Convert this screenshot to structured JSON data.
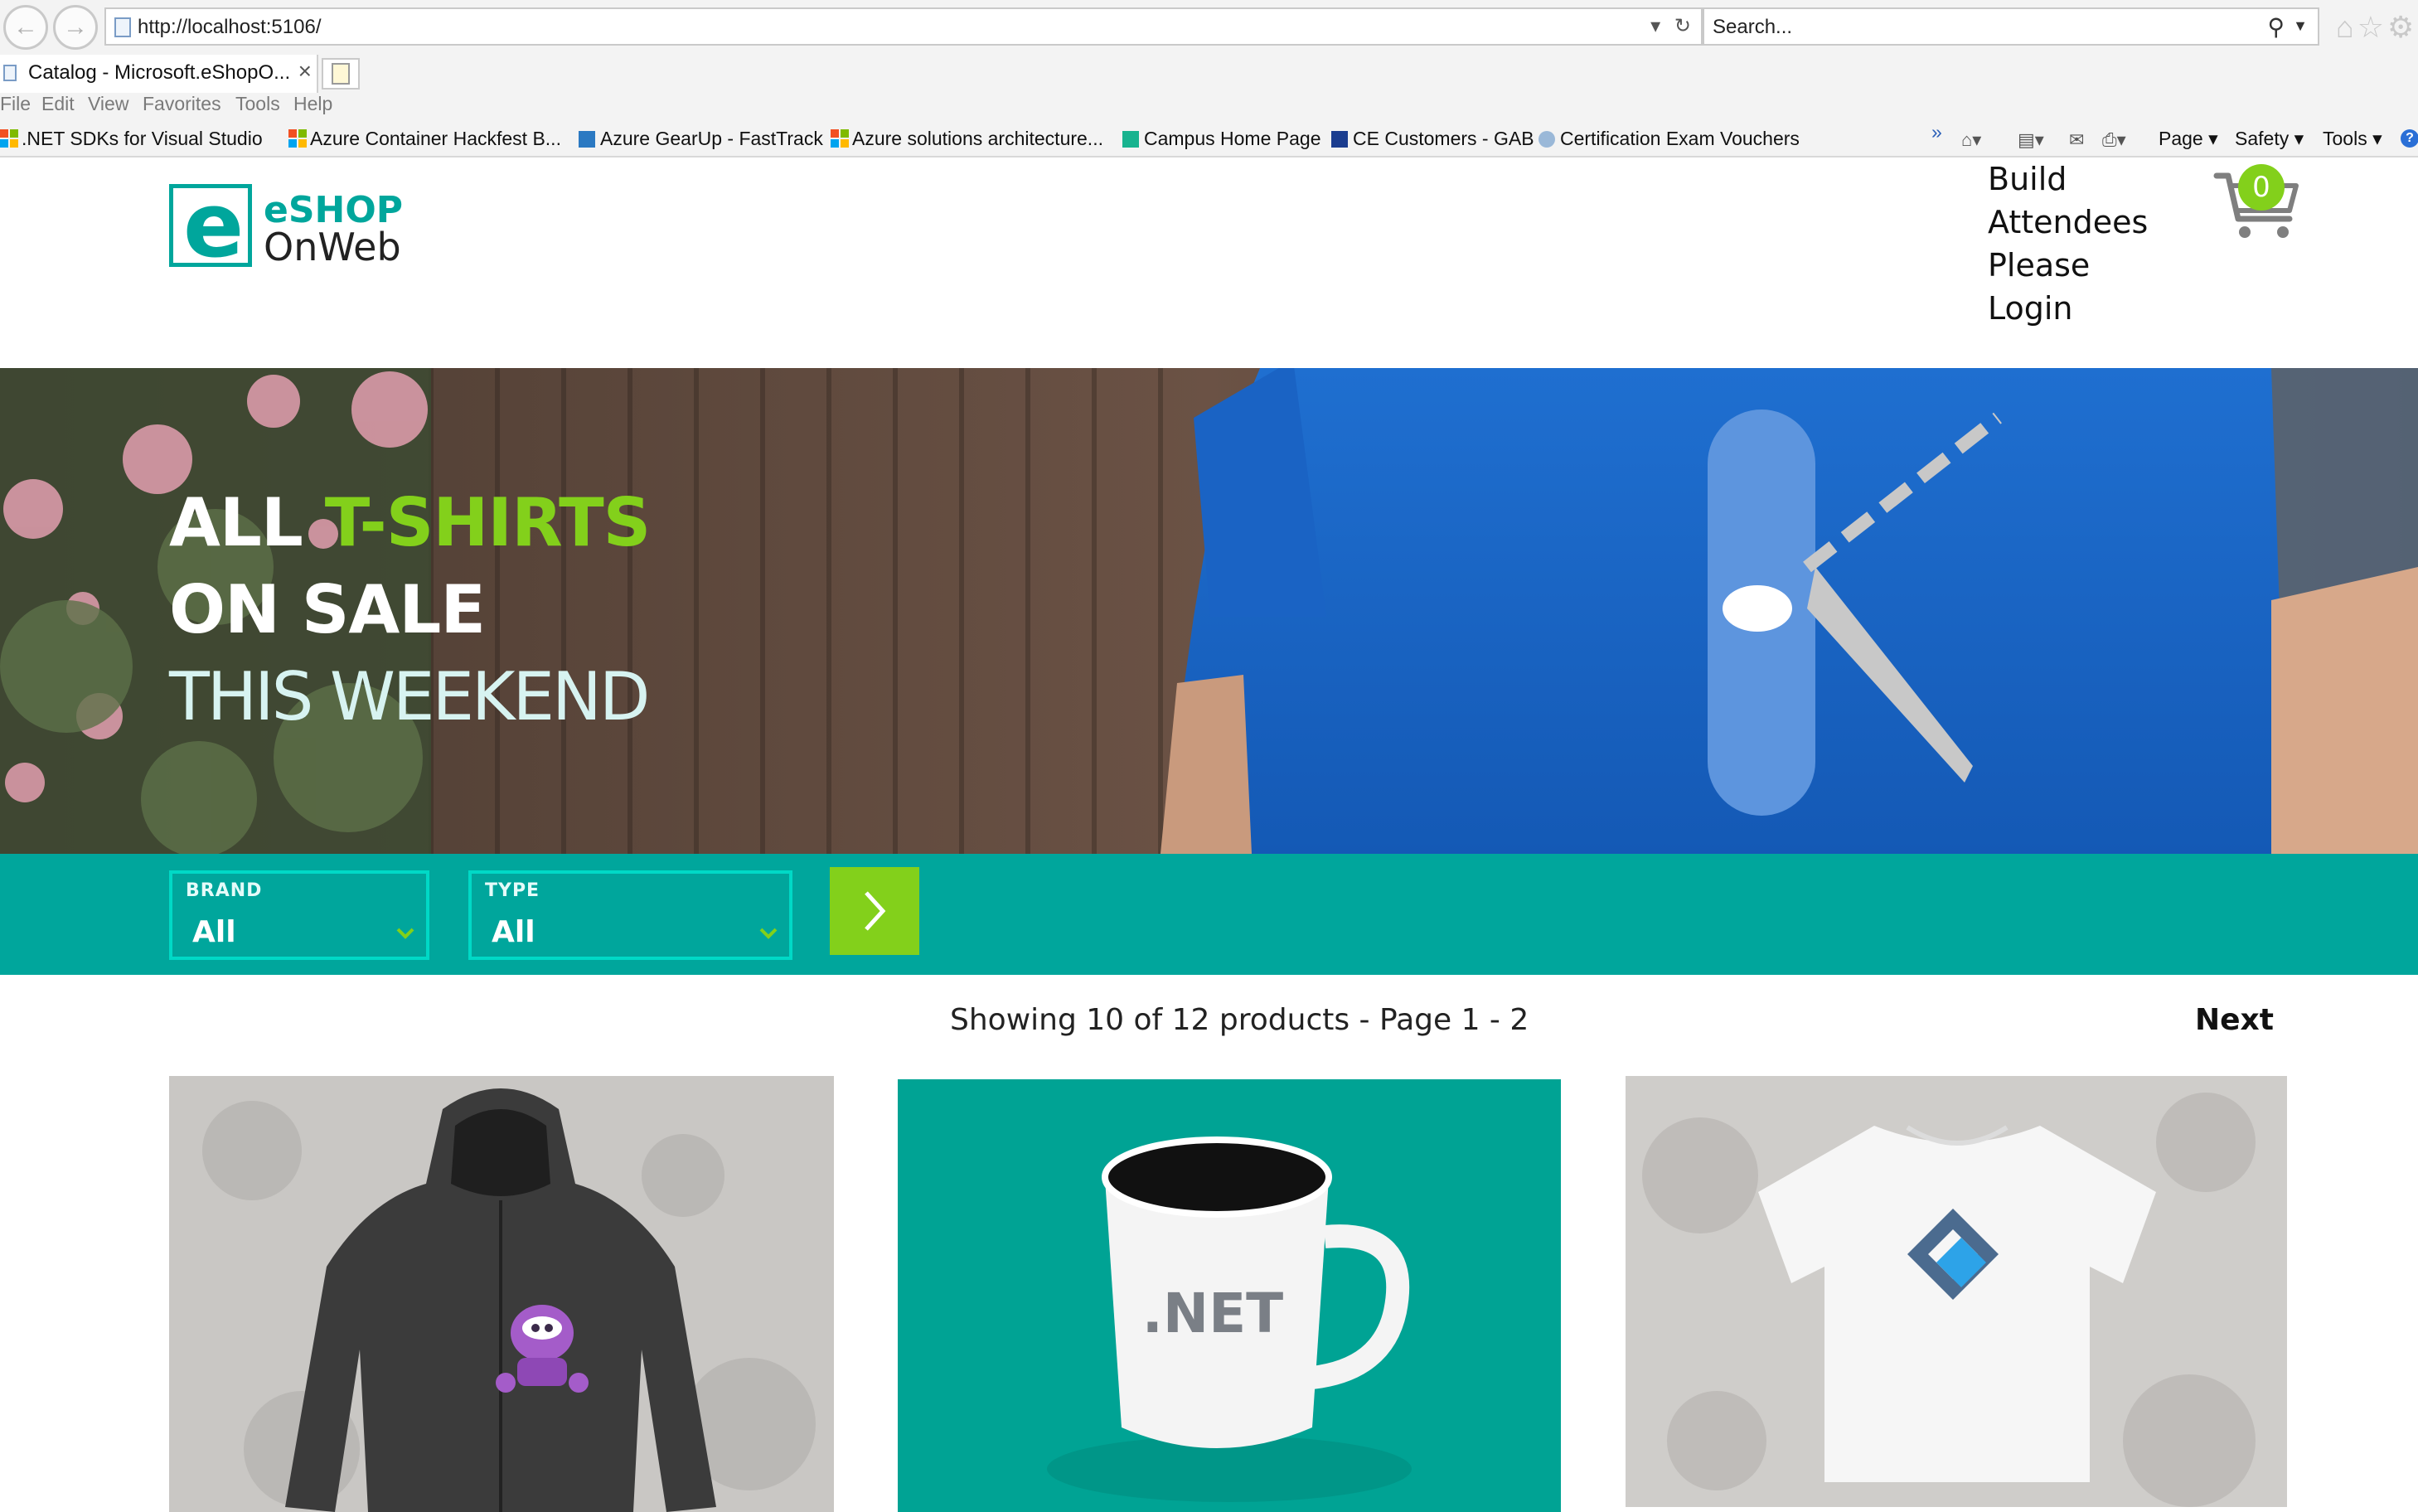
{
  "browser": {
    "url": "http://localhost:5106/",
    "search_placeholder": "Search...",
    "tab_title": "Catalog - Microsoft.eShopO...",
    "tab_close": "×",
    "menu": [
      "File",
      "Edit",
      "View",
      "Favorites",
      "Tools",
      "Help"
    ],
    "favorites": [
      ".NET SDKs for Visual Studio",
      "Azure Container Hackfest B...",
      "Azure GearUp - FastTrack",
      "Azure solutions architecture...",
      "Campus Home Page",
      "CE Customers - GAB",
      "Certification Exam Vouchers"
    ],
    "command_bar": {
      "more": "»",
      "page": "Page",
      "safety": "Safety",
      "tools": "Tools",
      "help": "?"
    }
  },
  "site": {
    "logo_line1": "eSHOP",
    "logo_line2": "OnWeb",
    "logo_letter": "e",
    "login_lines": [
      "Build",
      "Attendees",
      "Please",
      "Login"
    ],
    "cart_count": "0",
    "hero": {
      "line1_white": "ALL ",
      "line1_accent": "T-SHIRTS",
      "line2": "ON SALE",
      "line3": "THIS WEEKEND"
    },
    "filters": {
      "brand_label": "BRAND",
      "brand_value": "All",
      "type_label": "TYPE",
      "type_value": "All"
    },
    "pager": {
      "info": "Showing 10 of 12 products - Page 1 - 2",
      "next": "Next"
    },
    "products": [
      {
        "image": "hoodie-with-purple-robot-logo"
      },
      {
        "image": "white-mug-with-NET-logo",
        "mug_text": ".NET"
      },
      {
        "image": "white-tshirt-with-blue-diamond-logo"
      }
    ]
  },
  "colors": {
    "brand_teal": "#00a69c",
    "accent_green": "#83d01b",
    "filter_border": "#00d9c6"
  }
}
